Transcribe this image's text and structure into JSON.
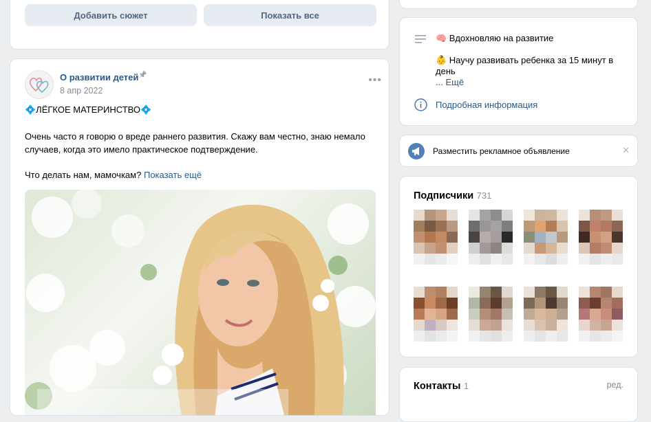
{
  "top_buttons": {
    "add_story": "Добавить сюжет",
    "show_all": "Показать все"
  },
  "post": {
    "author": "О развитии детей",
    "date": "8 апр 2022",
    "heading": "💠ЛЁГКОЕ МАТЕРИНСТВО💠",
    "paragraph": "Очень часто я говорю о вреде раннего развития. Скажу вам честно, знаю немало случаев, когда это имело практическое подтверждение.",
    "question": "Что делать нам, мамочкам?",
    "show_more": "Показать ещё",
    "menu": "•••",
    "pin": "📌"
  },
  "info": {
    "line1": "🧠 Вдохновляю на развитие",
    "line2": "👶 Научу развивать ребенка за 15 минут в день",
    "more": "... Ещё",
    "details": "Подробная информация"
  },
  "ad": {
    "label": "Разместить рекламное объявление",
    "close": "✕"
  },
  "subscribers": {
    "title": "Подписчики",
    "count": "731"
  },
  "contacts": {
    "title": "Контакты",
    "count": "1",
    "edit": "ред."
  },
  "icons": {
    "menu": "menu-lines-icon",
    "info": "info-icon",
    "megaphone": "megaphone-icon",
    "close": "close-icon"
  },
  "colors": {
    "link": "#2a5885",
    "button_bg": "#e5ebf1",
    "button_text": "#55677d",
    "page_bg": "#edeef0"
  }
}
